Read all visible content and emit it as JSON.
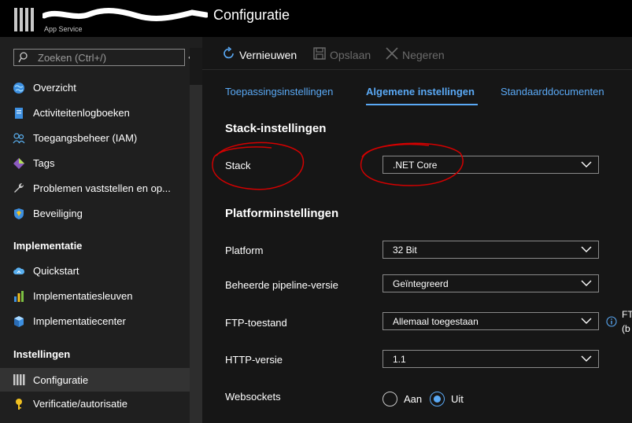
{
  "header": {
    "app_subtitle": "App Service",
    "page_title": "Configuratie"
  },
  "sidebar": {
    "search_placeholder": "Zoeken (Ctrl+/)",
    "collapse_symbol": "«",
    "items": [
      {
        "label": "Overzicht",
        "icon": "globe-icon"
      },
      {
        "label": "Activiteitenlogboeken",
        "icon": "log-icon"
      },
      {
        "label": "Toegangsbeheer (IAM)",
        "icon": "people-icon"
      },
      {
        "label": "Tags",
        "icon": "tag-icon"
      },
      {
        "label": "Problemen vaststellen en op...",
        "icon": "wrench-icon"
      },
      {
        "label": "Beveiliging",
        "icon": "shield-icon"
      }
    ],
    "section_implementatie": "Implementatie",
    "impl_items": [
      {
        "label": "Quickstart",
        "icon": "cloud-icon"
      },
      {
        "label": "Implementatiesleuven",
        "icon": "slots-icon"
      },
      {
        "label": "Implementatiecenter",
        "icon": "cube-icon"
      }
    ],
    "section_instellingen": "Instellingen",
    "settings_items": [
      {
        "label": "Configuratie",
        "icon": "config-bars-icon",
        "active": true
      },
      {
        "label": "Verificatie/autorisatie",
        "icon": "key-icon"
      }
    ]
  },
  "toolbar": {
    "refresh": "Vernieuwen",
    "save": "Opslaan",
    "discard": "Negeren"
  },
  "tabs": [
    {
      "label": "Toepassingsinstellingen",
      "active": false
    },
    {
      "label": "Algemene instellingen",
      "active": true
    },
    {
      "label": "Standaarddocumenten",
      "active": false
    }
  ],
  "form": {
    "stack_section": "Stack-instellingen",
    "stack_label": "Stack",
    "stack_value": ".NET Core",
    "platform_section": "Platforminstellingen",
    "platform_label": "Platform",
    "platform_value": "32 Bit",
    "pipeline_label": "Beheerde pipeline-versie",
    "pipeline_value": "Geïntegreerd",
    "ftp_label": "FTP-toestand",
    "ftp_value": "Allemaal toegestaan",
    "ftp_overflow_1": "FT",
    "ftp_overflow_2": "(b",
    "http_label": "HTTP-versie",
    "http_value": "1.1",
    "websockets_label": "Websockets",
    "websockets_on": "Aan",
    "websockets_off": "Uit",
    "websockets_selected": "Uit"
  },
  "colors": {
    "accent": "#5aa9f5",
    "annotation": "#d40000"
  }
}
